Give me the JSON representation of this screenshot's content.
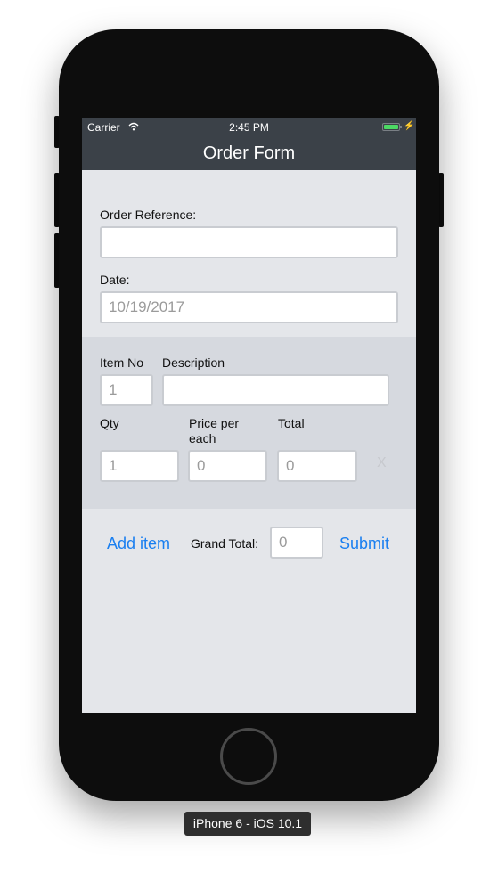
{
  "status_bar": {
    "carrier": "Carrier",
    "time": "2:45 PM"
  },
  "nav": {
    "title": "Order Form"
  },
  "form": {
    "order_reference_label": "Order Reference:",
    "order_reference_value": "",
    "date_label": "Date:",
    "date_placeholder": "10/19/2017"
  },
  "item": {
    "item_no_label": "Item No",
    "item_no_placeholder": "1",
    "description_label": "Description",
    "description_value": "",
    "qty_label": "Qty",
    "qty_placeholder": "1",
    "price_label": "Price per each",
    "price_placeholder": "0",
    "total_label": "Total",
    "total_placeholder": "0",
    "remove_label": "X"
  },
  "footer": {
    "add_item_label": "Add item",
    "grand_total_label": "Grand Total:",
    "grand_total_placeholder": "0",
    "submit_label": "Submit"
  },
  "device": {
    "label": "iPhone 6 - iOS 10.1"
  },
  "colors": {
    "nav_bg": "#3b4148",
    "screen_bg": "#e4e6ea",
    "item_section_bg": "#d6d9df",
    "link": "#1a7ff0",
    "battery": "#4cd964"
  },
  "icons": {
    "signal": "wifi-icon",
    "battery": "battery-icon",
    "charging": "charging-bolt-icon",
    "home": "home-button-icon"
  }
}
